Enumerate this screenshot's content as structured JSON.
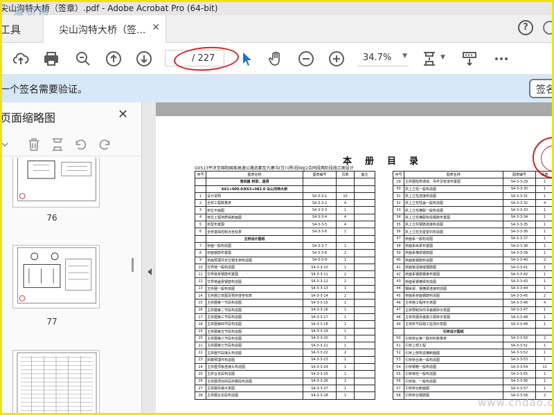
{
  "window": {
    "title": "尖山沟特大桥（签章）.pdf - Adobe Acrobat Pro (64-bit)"
  },
  "tabs": {
    "tools": "工具",
    "document": "尖山沟特大桥（签..."
  },
  "toolbar": {
    "page_current": "",
    "page_total": "/ 227",
    "zoom": "34.7%"
  },
  "signature_bar": {
    "message": "一个签名需要验证。",
    "button": "签名"
  },
  "side_panel": {
    "title": "页面缩略图",
    "thumbnails": [
      {
        "number": "76"
      },
      {
        "number": "77"
      }
    ]
  },
  "document": {
    "title": "本册目录",
    "subtitle": "G0513平凉至绵阳国家高速公路武都至九寨沟(甘川界)段WJJ1合同段两阶段施工图设计",
    "table_headers": [
      "序号",
      "图表名称",
      "图表编号",
      "页数",
      "备注"
    ],
    "left_rows": [
      {
        "no": "",
        "name": "第四篇 桥梁、涵洞",
        "code": "",
        "pages": "",
        "style": "b"
      },
      {
        "no": "",
        "name": "K61+000.0/K63+082.0 尖山沟特大桥",
        "code": "",
        "pages": "",
        "style": "b"
      },
      {
        "no": "1",
        "name": "设计说明",
        "code": "S4-3-3-1",
        "pages": "10"
      },
      {
        "no": "2",
        "name": "全桥工程数量表",
        "code": "S4-3-3-2",
        "pages": "4"
      },
      {
        "no": "3",
        "name": "桥位平面图",
        "code": "S4-3-3-3",
        "pages": "1"
      },
      {
        "no": "4",
        "name": "桥位工程地质纵断面图",
        "code": "S4-3-3-4",
        "pages": "4"
      },
      {
        "no": "5",
        "name": "桥型布置图",
        "code": "S4-3-3-5",
        "pages": "4"
      },
      {
        "no": "6",
        "name": "全桥基础控制点坐标表",
        "code": "S4-3-3-6",
        "pages": "1"
      },
      {
        "no": "",
        "name": "主桥设计图纸",
        "code": "",
        "pages": "",
        "style": "b"
      },
      {
        "no": "7",
        "name": "桥面一般构造图",
        "code": "S4-3-3-7",
        "pages": "1"
      },
      {
        "no": "8",
        "name": "桥面钢筋布置图",
        "code": "S4-3-3-8",
        "pages": "2"
      },
      {
        "no": "9",
        "name": "桥面预埋件定位钢支架构造图",
        "code": "S4-3-3-9",
        "pages": "1"
      },
      {
        "no": "10",
        "name": "交界墩一般构造图",
        "code": "S4-3-3-10",
        "pages": "1"
      },
      {
        "no": "11",
        "name": "交界墩身钢筋布置图",
        "code": "S4-3-3-11",
        "pages": "2"
      },
      {
        "no": "12",
        "name": "交界墩盖梁钢筋构造图",
        "code": "S4-3-3-12",
        "pages": "2"
      },
      {
        "no": "13",
        "name": "主拱圈一般构造图",
        "code": "S4-3-3-13",
        "pages": "1"
      },
      {
        "no": "14",
        "name": "主拱圈立体图及预拱度坐标表",
        "code": "S4-3-3-14",
        "pages": "2"
      },
      {
        "no": "15",
        "name": "主拱圈第一节段构造图",
        "code": "S4-3-3-15",
        "pages": "1"
      },
      {
        "no": "16",
        "name": "主拱圈第二节段构造图",
        "code": "S4-3-3-16",
        "pages": "1"
      },
      {
        "no": "17",
        "name": "主拱圈第三节段构造图",
        "code": "S4-3-3-17",
        "pages": "1"
      },
      {
        "no": "18",
        "name": "主拱圈第四节段构造图",
        "code": "S4-3-3-18",
        "pages": "1"
      },
      {
        "no": "19",
        "name": "主拱圈第五节段构造图",
        "code": "S4-3-3-19",
        "pages": "1"
      },
      {
        "no": "20",
        "name": "主拱圈第六节段构造图",
        "code": "S4-3-3-20",
        "pages": "1"
      },
      {
        "no": "21",
        "name": "主拱圈第七节段构造图",
        "code": "S4-3-3-21",
        "pages": "1"
      },
      {
        "no": "22",
        "name": "主拱圈节段接头构造图",
        "code": "S4-3-3-22",
        "pages": "2"
      },
      {
        "no": "23",
        "name": "拱脚预埋件构造图",
        "code": "S4-3-3-23",
        "pages": "1"
      },
      {
        "no": "24",
        "name": "主拱圈顶板连接头构造图",
        "code": "S4-3-3-24",
        "pages": "1"
      },
      {
        "no": "25",
        "name": "主拱合龙段构造图",
        "code": "S4-3-3-25",
        "pages": "1"
      },
      {
        "no": "26",
        "name": "主拱圈顶完拱段拱脚段构造图",
        "code": "S4-3-3-26",
        "pages": "1"
      },
      {
        "no": "27",
        "name": "主拱圈吊装示意图",
        "code": "S4-3-3-27",
        "pages": "1"
      },
      {
        "no": "28",
        "name": "主拱圈合龙段构造图",
        "code": "S4-3-3-28",
        "pages": "1"
      }
    ],
    "right_rows": [
      {
        "no": "29",
        "name": "主拱圈检修通道、吊杆及管道布置图",
        "code": "S4-3-3-29",
        "pages": "1"
      },
      {
        "no": "30",
        "name": "拱上立柱一般构造图",
        "code": "S4-3-3-30",
        "pages": "1"
      },
      {
        "no": "31",
        "name": "拱上立柱连接构造图",
        "code": "S4-3-3-31",
        "pages": "1"
      },
      {
        "no": "32",
        "name": "拱上立柱柱盖一般构造图",
        "code": "S4-3-3-32",
        "pages": "4"
      },
      {
        "no": "33",
        "name": "拱上立柱横联一般构造图",
        "code": "S4-3-3-33",
        "pages": "1"
      },
      {
        "no": "34",
        "name": "拱上立柱横联构造钢筋布置图",
        "code": "S4-3-3-34",
        "pages": "1"
      },
      {
        "no": "35",
        "name": "拱上立柱钢筋连接构造图",
        "code": "S4-3-3-35",
        "pages": "1"
      },
      {
        "no": "36",
        "name": "拱上立柱支座垫石构造图",
        "code": "S4-3-3-36",
        "pages": "1"
      },
      {
        "no": "37",
        "name": "桥面系一般构造图",
        "code": "S4-3-3-37",
        "pages": "1"
      },
      {
        "no": "38",
        "name": "桥面系纵梁布置图",
        "code": "S4-3-3-38",
        "pages": "1"
      },
      {
        "no": "39",
        "name": "桥面系横梁钢筋图",
        "code": "S4-3-3-39",
        "pages": "1"
      },
      {
        "no": "40",
        "name": "桥面板钢筋构造图",
        "code": "S4-3-3-40",
        "pages": "2"
      },
      {
        "no": "41",
        "name": "桥面板湿接缝钢筋图",
        "code": "S4-3-3-41",
        "pages": "1"
      },
      {
        "no": "42",
        "name": "桥面系钢筋钢束布置图",
        "code": "S4-3-3-42",
        "pages": "1"
      },
      {
        "no": "43",
        "name": "桥面系钢横梁构造图",
        "code": "S4-3-3-43",
        "pages": "1"
      },
      {
        "no": "44",
        "name": "钢纵梁、钢横梁连接构造图",
        "code": "S4-3-3-44",
        "pages": "1"
      },
      {
        "no": "45",
        "name": "桥面系桥面钢筋构造图",
        "code": "S4-3-3-45",
        "pages": "2"
      },
      {
        "no": "46",
        "name": "主桥施工程序示意图",
        "code": "S4-3-3-46",
        "pages": "4"
      },
      {
        "no": "47",
        "name": "主桥预制块件吊装顺序示意图",
        "code": "S4-3-3-47",
        "pages": "1"
      },
      {
        "no": "48",
        "name": "主桥拱圈吊装施工顺序示意图",
        "code": "S4-3-3-48",
        "pages": "1"
      },
      {
        "no": "49",
        "name": "主桥拱节段施工监测示意图",
        "code": "S4-3-3-49",
        "pages": "1"
      },
      {
        "no": "",
        "name": "引桥设计图纸",
        "code": "",
        "pages": "",
        "style": "b"
      },
      {
        "no": "50",
        "name": "引桥桥台第一联材料数量表",
        "code": "S4-3-3-50",
        "pages": "2"
      },
      {
        "no": "51",
        "name": "引桥上部工程",
        "code": "S4-3-3-51",
        "pages": "1"
      },
      {
        "no": "52",
        "name": "引桥上部构造横断面图",
        "code": "S4-3-3-52",
        "pages": "1"
      },
      {
        "no": "53",
        "name": "引桥桥台第一般构造图",
        "code": "S4-3-3-53",
        "pages": "1"
      },
      {
        "no": "54",
        "name": "引桥钢箱一般构造图",
        "code": "S4-3-3-54",
        "pages": "11"
      },
      {
        "no": "55",
        "name": "引桥墩柱一般构造图",
        "code": "S4-3-3-55",
        "pages": "1"
      },
      {
        "no": "56",
        "name": "引桥墩、一般构造图",
        "code": "S4-3-3-56",
        "pages": "1"
      },
      {
        "no": "57",
        "name": "引桥桥台断面图",
        "code": "S4-3-3-57",
        "pages": "1"
      },
      {
        "no": "58",
        "name": "引桥桥台钢筋图",
        "code": "S4-3-3-58",
        "pages": "2"
      }
    ]
  },
  "watermarks": {
    "top_left": "道桥网",
    "bottom_right": "www.cndao.com"
  },
  "colors": {
    "highlight_frame": "#f4e20b",
    "annotation_oval": "#e01e1e",
    "signature_bar_bg": "#d6e8f7",
    "cursor_blue": "#1f6fd6"
  }
}
